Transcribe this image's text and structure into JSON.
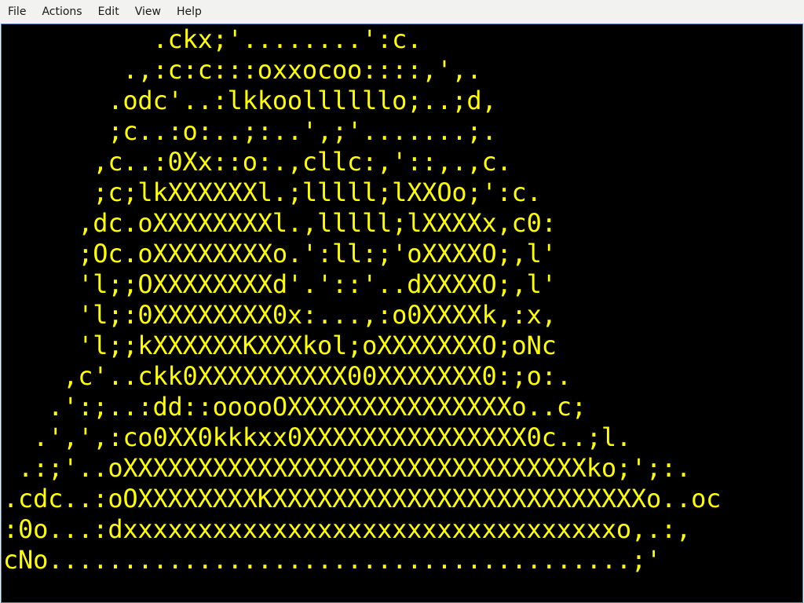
{
  "menu": {
    "items": [
      "File",
      "Actions",
      "Edit",
      "View",
      "Help"
    ]
  },
  "colors": {
    "terminal_bg": "#000000",
    "terminal_fg": "#ffff00",
    "menubar_bg": "#f2f2f0"
  },
  "terminal": {
    "lines": [
      "          .ckx;'........':c.",
      "        .,:c:c:::oxxocoo::::,',.",
      "       .odc'..:lkkoollllllo;..;d,",
      "       ;c..:o:..;:..',;'.......;.",
      "      ,c..:0Xx::o:.,cllc:,'::,.,c.",
      "      ;c;lkXXXXXXl.;lllll;lXXOo;':c.",
      "     ,dc.oXXXXXXXXl.,lllll;lXXXXx,c0:",
      "     ;Oc.oXXXXXXXXo.':ll:;'oXXXXO;,l'",
      "     'l;;OXXXXXXXXd'.'::'..dXXXXO;,l'",
      "     'l;:0XXXXXXXX0x:...,:o0XXXXk,:x,",
      "     'l;;kXXXXXXKXXXkol;oXXXXXXXO;oNc",
      "    ,c'..ckk0XXXXXXXXXX00XXXXXXX0:;o:.",
      "   .':;..:dd::ooooOXXXXXXXXXXXXXXXo..c;",
      "  .',',:co0XX0kkkxx0XXXXXXXXXXXXXXX0c..;l.",
      " .:;'..oXXXXXXXXXXXXXXXXXXXXXXXXXXXXXXXko;';:.",
      ".cdc..:oOXXXXXXXXKXXXXXXXXXXXXXXXXXXXXXXXXXo..oc",
      ":0o...:dxxxxxxxxxxxxxxxxxxxxxxxxxxxxxxxxxo,.:,",
      "cNo.......................................;'"
    ]
  }
}
